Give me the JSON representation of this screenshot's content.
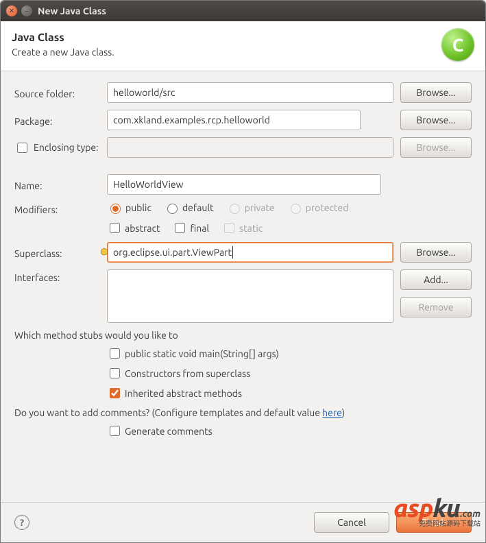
{
  "window": {
    "title": "New Java Class"
  },
  "header": {
    "title": "Java Class",
    "subtitle": "Create a new Java class.",
    "iconLetter": "C"
  },
  "labels": {
    "sourceFolder": "Source folder:",
    "package": "Package:",
    "enclosingType": "Enclosing type:",
    "name": "Name:",
    "modifiers": "Modifiers:",
    "superclass": "Superclass:",
    "interfaces": "Interfaces:"
  },
  "fields": {
    "sourceFolder": "helloworld/src",
    "package": "com.xkland.examples.rcp.helloworld",
    "enclosingType": "",
    "name": "HelloWorldView",
    "superclass": "org.eclipse.ui.part.ViewPart"
  },
  "buttons": {
    "browse": "Browse...",
    "add": "Add...",
    "remove": "Remove",
    "cancel": "Cancel",
    "finish": "Finish"
  },
  "modifiers": {
    "access": {
      "public": "public",
      "default": "default",
      "private": "private",
      "protected": "protected",
      "selected": "public"
    },
    "abstract": "abstract",
    "final": "final",
    "static": "static"
  },
  "stubs": {
    "question": "Which method stubs would you like to",
    "main": "public static void main(String[] args)",
    "constructors": "Constructors from superclass",
    "inherited": "Inherited abstract methods"
  },
  "comments": {
    "question_prefix": "Do you want to add comments? (Configure templates and default value ",
    "link": "here",
    "question_suffix": ")",
    "generate": "Generate comments"
  },
  "watermark": {
    "brand_a": "asp",
    "brand_b": "ku",
    "dot": ".com",
    "sub": "免费网站源码下载站"
  }
}
